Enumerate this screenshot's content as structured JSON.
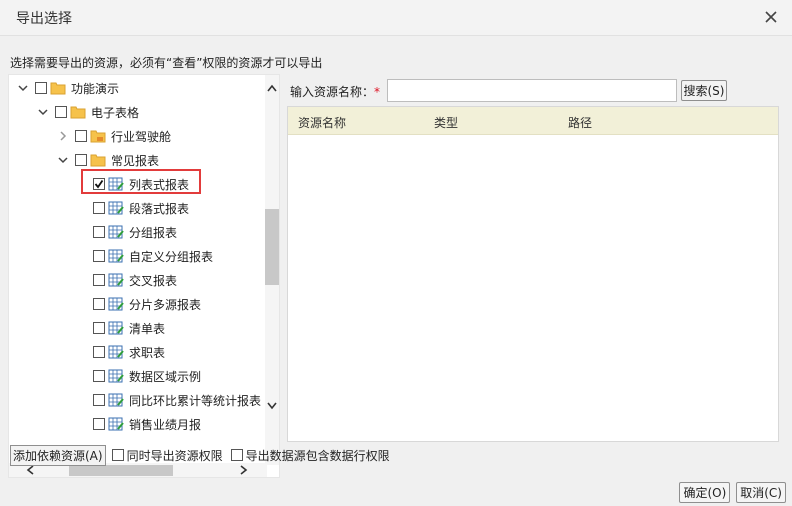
{
  "dialog": {
    "title": "导出选择",
    "hint": "选择需要导出的资源，必须有“查看”权限的资源才可以导出"
  },
  "tree": {
    "nodes": [
      {
        "label": "功能演示",
        "type": "folder",
        "expanded": true,
        "checked": false
      },
      {
        "label": "电子表格",
        "type": "folder",
        "expanded": true,
        "checked": false
      },
      {
        "label": "行业驾驶舱",
        "type": "folder",
        "expanded": false,
        "checked": false
      },
      {
        "label": "常见报表",
        "type": "folder",
        "expanded": true,
        "checked": false
      },
      {
        "label": "列表式报表",
        "type": "report",
        "checked": true
      },
      {
        "label": "段落式报表",
        "type": "report",
        "checked": false
      },
      {
        "label": "分组报表",
        "type": "report",
        "checked": false
      },
      {
        "label": "自定义分组报表",
        "type": "report",
        "checked": false
      },
      {
        "label": "交叉报表",
        "type": "report",
        "checked": false
      },
      {
        "label": "分片多源报表",
        "type": "report",
        "checked": false
      },
      {
        "label": "清单表",
        "type": "report",
        "checked": false
      },
      {
        "label": "求职表",
        "type": "report",
        "checked": false
      },
      {
        "label": "数据区域示例",
        "type": "report",
        "checked": false
      },
      {
        "label": "同比环比累计等统计报表",
        "type": "report",
        "checked": false
      },
      {
        "label": "销售业绩月报",
        "type": "report",
        "checked": false
      }
    ]
  },
  "search": {
    "label": "输入资源名称：",
    "required_mark": "*",
    "value": "",
    "placeholder": "",
    "button_label": "搜索(S)"
  },
  "results": {
    "columns": [
      "资源名称",
      "类型",
      "路径"
    ],
    "rows": []
  },
  "options": {
    "add_dependency_label": "添加依赖资源(A)",
    "export_permissions_label": "同时导出资源权限",
    "export_datasource_row_perm_label": "导出数据源包含数据行权限"
  },
  "footer": {
    "ok_label": "确定(O)",
    "cancel_label": "取消(C)"
  },
  "colors": {
    "highlight": "#e23b3b",
    "folder": "#f6c24b",
    "results_header": "#f2f0d8"
  }
}
